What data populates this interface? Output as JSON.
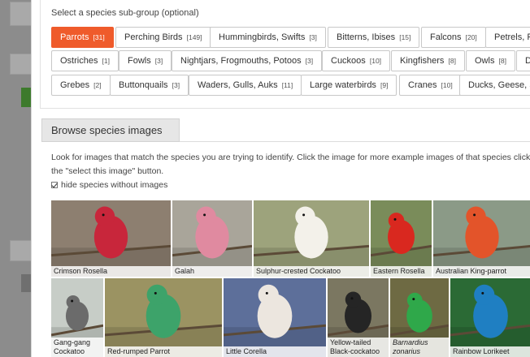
{
  "subgroup_prompt": "Select a species sub-group (optional)",
  "chip_rows": [
    [
      {
        "label": "Parrots",
        "count": "[31]",
        "active": true
      },
      {
        "label": "Perching Birds",
        "count": "[149]"
      },
      {
        "label": "Hummingbirds, Swifts",
        "count": "[3]"
      },
      {
        "label": "Bitterns, Ibises",
        "count": "[15]"
      },
      {
        "label": "Falcons",
        "count": "[20]"
      },
      {
        "label": "Petrels, Fr",
        "count": ""
      }
    ],
    [
      {
        "label": "Ostriches",
        "count": "[1]"
      },
      {
        "label": "Fowls",
        "count": "[3]"
      },
      {
        "label": "Nightjars, Frogmouths, Potoos",
        "count": "[3]"
      },
      {
        "label": "Cuckoos",
        "count": "[10]"
      },
      {
        "label": "Kingfishers",
        "count": "[8]"
      },
      {
        "label": "Owls",
        "count": "[8]"
      },
      {
        "label": "Do",
        "count": ""
      }
    ],
    [
      {
        "label": "Grebes",
        "count": "[2]"
      },
      {
        "label": "Buttonquails",
        "count": "[3]"
      },
      {
        "label": "Waders, Gulls, Auks",
        "count": "[11]"
      },
      {
        "label": "Large waterbirds",
        "count": "[9]"
      },
      {
        "label": "Cranes",
        "count": "[10]"
      },
      {
        "label": "Ducks, Geese, Sw",
        "count": ""
      }
    ]
  ],
  "browse": {
    "header": "Browse species images",
    "description": "Look for images that match the species you are trying to identify. Click the image for more example images of that species click the \"select this image\" button.",
    "hide_label": "hide species without images"
  },
  "tiles": [
    {
      "caption": "Crimson Rosella",
      "bird": "#c8263b",
      "bg": "#8d7f70"
    },
    {
      "caption": "Galah",
      "bird": "#e08aa0",
      "bg": "#a9a59a"
    },
    {
      "caption": "Sulphur-crested Cockatoo",
      "bird": "#f3f1ea",
      "bg": "#9da37c"
    },
    {
      "caption": "Eastern Rosella",
      "bird": "#d9281f",
      "bg": "#7a8c5a"
    },
    {
      "caption": "Australian King-parrot",
      "bird": "#e3542a",
      "bg": "#8b9a87"
    },
    {
      "caption": "Gang-gang Cockatoo",
      "bird": "#6b6b6b",
      "bg": "#c7cdc7"
    },
    {
      "caption": "Red-rumped Parrot",
      "bird": "#3da36a",
      "bg": "#9b9362"
    },
    {
      "caption": "Little Corella",
      "bird": "#ece6df",
      "bg": "#5d6f9a"
    },
    {
      "caption": "Yellow-tailed Black-cockatoo",
      "bird": "#252525",
      "bg": "#7b7761"
    },
    {
      "caption": "Barnardius zonarius",
      "italic": true,
      "bird": "#2fa84a",
      "bg": "#6e6a43"
    },
    {
      "caption": "Rainbow Lorikeet",
      "bird": "#1f7fc2",
      "bg": "#2b6a35"
    }
  ],
  "colors": {
    "active_chip": "#ef5b2b"
  }
}
